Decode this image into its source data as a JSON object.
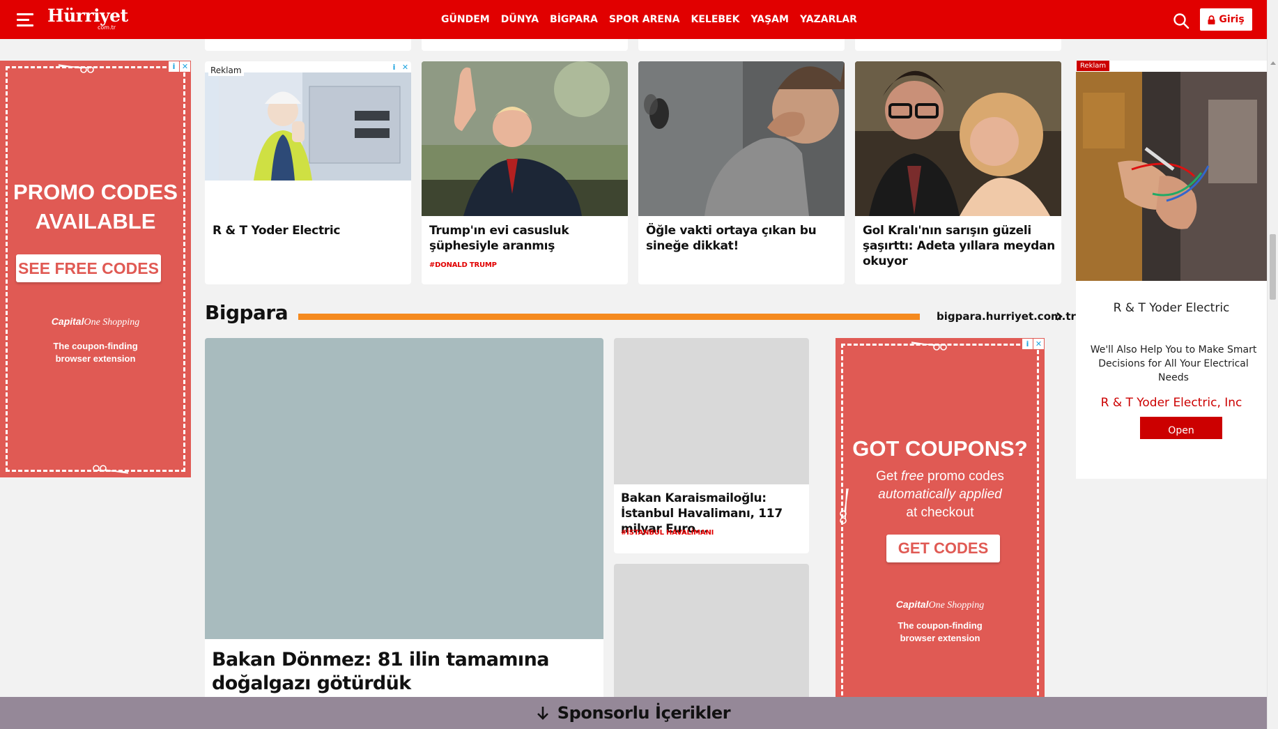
{
  "header": {
    "logo": "Hürriyet",
    "logo_sub": "com.tr",
    "nav": [
      "GÜNDEM",
      "DÜNYA",
      "BİGPARA",
      "SPOR ARENA",
      "KELEBEK",
      "YAŞAM",
      "YAZARLAR"
    ],
    "login_label": "Giriş"
  },
  "left_ad": {
    "headline_1": "PROMO CODES",
    "headline_2": "AVAILABLE",
    "button": "SEE FREE CODES",
    "brand_bold": "Capital",
    "brand_rest": "One Shopping",
    "tagline_1": "The coupon-finding",
    "tagline_2": "browser extension"
  },
  "news_row": [
    {
      "sponsored_label": "Reklam",
      "title": "R & T Yoder Electric",
      "tag": ""
    },
    {
      "title": "Trump'ın evi casusluk şüphesiyle aranmış",
      "tag": "#DONALD TRUMP"
    },
    {
      "title": "Öğle vakti ortaya çıkan bu sineğe dikkat!",
      "tag": ""
    },
    {
      "title": "Gol Kralı'nın sarışın güzeli şaşırttı: Adeta yıllara meydan okuyor",
      "tag": ""
    }
  ],
  "right_ad": {
    "label": "Reklam",
    "title": "R & T Yoder Electric",
    "description": "We'll Also Help You to Make Smart Decisions for All Your Electrical Needs",
    "brand": "R & T Yoder Electric, Inc",
    "button": "Open"
  },
  "bigpara": {
    "title": "Bigpara",
    "link": "bigpara.hurriyet.com.tr",
    "main_story": {
      "title": "Bakan Dönmez: 81 ilin tamamına doğalgazı götürdük"
    },
    "side_story_1": {
      "title": "Bakan Karaismailoğlu: İstanbul Havalimanı, 117 milyar Euro...",
      "tag": "#İSTANBUL HAVALİMANI"
    }
  },
  "middle_ad": {
    "headline": "GOT COUPONS?",
    "line_1a": "Get ",
    "line_1b": "free",
    "line_1c": " promo codes",
    "line_2": "automatically applied",
    "line_3": "at checkout",
    "button": "GET CODES",
    "brand_bold": "Capital",
    "brand_rest": "One Shopping",
    "tagline_1": "The coupon-finding",
    "tagline_2": "browser extension"
  },
  "sponsor_bar": {
    "label": "Sponsorlu İçerikler"
  },
  "colors": {
    "brand_red": "#e10000",
    "coupon_red": "#e05a54",
    "bigpara_orange": "#f58a1f",
    "sponsor_bar": "#958898"
  }
}
